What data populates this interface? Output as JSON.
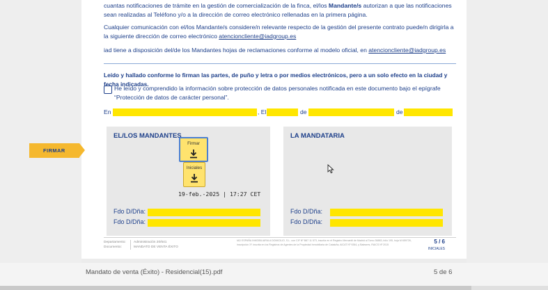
{
  "document": {
    "para1_a": "cuantas notificaciones de trámite en la gestión de comercialización de la finca, el/los ",
    "para1_bold": "Mandante/s",
    "para1_b": " autorizan a que las notificaciones sean realizadas al Teléfono y/o a la dirección de correo electrónico rellenadas en la primera página.",
    "para2_a": "Cualquier comunicación con el/los Mandante/s considere/n relevante respecto de la gestión del presente contrato puede/n dirigirla a la siguiente dirección de correo electrónico ",
    "para2_link": "atencioncliente@iadgroup.es",
    "para3_a": "iad tiene a disposición del/de los Mandantes hojas de reclamaciones conforme al modelo oficial, en ",
    "para3_link": "atencioncliente@iadgroup.es",
    "read_sign": "Leído y hallado conforme lo firman las partes, de puño y letra o por medios electrónicos, pero a un solo efecto en la ciudad y fecha indicadas.",
    "privacy_checkbox": "He leído y comprendido la información sobre protección de datos personales notificada en este documento bajo el epígrafe “Protección de datos de carácter personal”.",
    "date_row": {
      "en": "En",
      "el": ", El",
      "de1": "de",
      "de2": "de"
    },
    "mandantes_title": "EL/LOS MANDANTES",
    "mandataria_title": "LA MANDATARIA",
    "fdo_label": "Fdo D/Dña:",
    "timestamp": "19-feb.-2025 | 17:27 CET",
    "sign_button_label": "Firmar",
    "initials_button_label": "Iniciales",
    "footer": {
      "dept_label": "Departamento:",
      "doc_label": "Documento:",
      "dept_value": "Administración 20/641",
      "doc_value": "MANDATO DE VENTA ÉXITO",
      "legal": "IAD ESPAÑA INMOBILIARIA A DOMICILIO, S.L. con CIF Nº B87 11 573, inscrita en el Registro Mercantil de Madrid al Tomo 36883, folio 195, hoja M 659726, inscripción 1ª, inscrita en los Registros de Agentes de la Propiedad Inmobiliaria de Cataluña, AICAT Nº 9264, y Baleares, RAICS Nº 2015",
      "page": "5 / 6",
      "initials": "INICIALES"
    }
  },
  "overlay": {
    "firmar_tag": "FIRMAR"
  },
  "viewer": {
    "document_name": "Mandato de venta (Éxito) - Residencial(15).pdf",
    "page_indicator": "5 de 6",
    "progress": 0.86
  },
  "colors": {
    "text_blue": "#1d3f8a",
    "highlight_yellow": "#ffe600",
    "tag_orange": "#f5b82e"
  },
  "icons": [
    "download-arrow-icon",
    "mouse-pointer-icon"
  ]
}
